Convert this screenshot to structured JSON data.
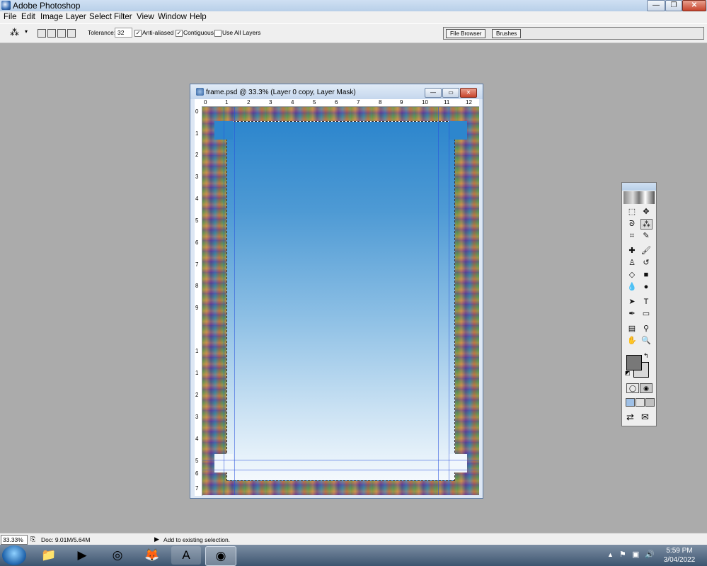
{
  "app": {
    "title": "Adobe Photoshop"
  },
  "window_controls": {
    "minimize": "—",
    "restore": "❐",
    "close": "✕"
  },
  "menu": [
    "File",
    "Edit",
    "Image",
    "Layer",
    "Select",
    "Filter",
    "View",
    "Window",
    "Help"
  ],
  "options_bar": {
    "tool_icon": "magic-wand-icon",
    "tolerance_label": "Tolerance:",
    "tolerance_value": "32",
    "anti_aliased_label": "Anti-aliased",
    "anti_aliased_checked": true,
    "contiguous_label": "Contiguous",
    "contiguous_checked": true,
    "use_all_layers_label": "Use All Layers",
    "use_all_layers_checked": false
  },
  "palette_well": {
    "tabs": [
      "File Browser",
      "Brushes"
    ]
  },
  "document": {
    "title": "frame.psd @ 33.3% (Layer 0 copy, Layer Mask)",
    "ruler_top": [
      "0",
      "1",
      "2",
      "3",
      "4",
      "5",
      "6",
      "7",
      "8",
      "9",
      "10",
      "11",
      "12"
    ],
    "ruler_left": [
      "0",
      "1",
      "2",
      "3",
      "4",
      "5",
      "6",
      "7",
      "8",
      "9",
      "1",
      "1",
      "2",
      "3",
      "4",
      "5",
      "6",
      "7"
    ],
    "gradient_top": "#2d86cd",
    "gradient_bottom": "#f4f9fd"
  },
  "toolbox": {
    "tools": [
      [
        "marquee-icon",
        "move-icon"
      ],
      [
        "lasso-icon",
        "magic-wand-icon"
      ],
      [
        "crop-icon",
        "slice-icon"
      ],
      [
        "healing-brush-icon",
        "brush-icon"
      ],
      [
        "clone-stamp-icon",
        "history-brush-icon"
      ],
      [
        "eraser-icon",
        "gradient-icon"
      ],
      [
        "blur-icon",
        "dodge-icon"
      ],
      [
        "path-select-icon",
        "type-icon"
      ],
      [
        "pen-icon",
        "rectangle-icon"
      ],
      [
        "notes-icon",
        "eyedropper-icon"
      ],
      [
        "hand-icon",
        "zoom-icon"
      ]
    ],
    "foreground_color": "#787878",
    "background_color": "#d8d8d8"
  },
  "status": {
    "zoom": "33.33%",
    "doc_size": "Doc: 9.01M/5.64M",
    "hint": "Add to existing selection."
  },
  "taskbar": {
    "apps": [
      "file-explorer-icon",
      "media-player-icon",
      "chrome-icon",
      "firefox-icon",
      "font-viewer-icon",
      "photoshop-icon"
    ],
    "time": "5:59 PM",
    "date": "3/04/2022"
  }
}
